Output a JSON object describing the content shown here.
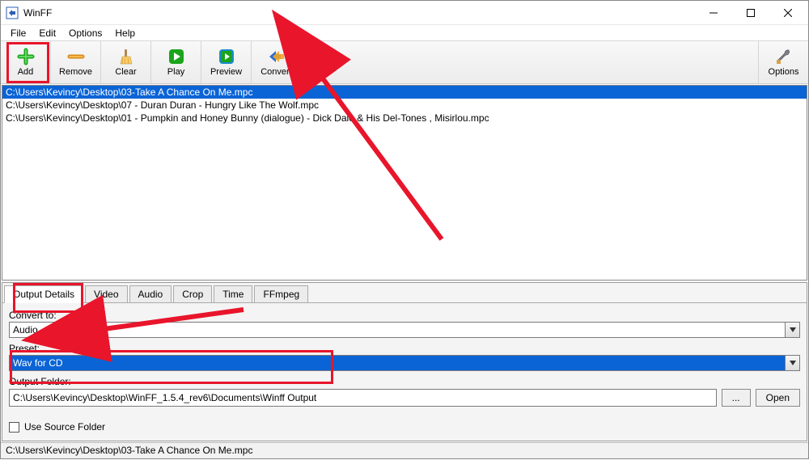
{
  "window": {
    "title": "WinFF"
  },
  "menu": {
    "items": [
      "File",
      "Edit",
      "Options",
      "Help"
    ]
  },
  "toolbar": {
    "add": "Add",
    "remove": "Remove",
    "clear": "Clear",
    "play": "Play",
    "preview": "Preview",
    "convert": "Convert",
    "options": "Options"
  },
  "files": [
    {
      "path": "C:\\Users\\Kevincy\\Desktop\\03-Take A Chance On Me.mpc",
      "selected": true
    },
    {
      "path": "C:\\Users\\Kevincy\\Desktop\\07 - Duran Duran - Hungry Like The Wolf.mpc",
      "selected": false
    },
    {
      "path": "C:\\Users\\Kevincy\\Desktop\\01 - Pumpkin and Honey Bunny (dialogue) - Dick Dale & His Del-Tones , Misirlou.mpc",
      "selected": false
    }
  ],
  "tabs": {
    "labels": [
      "Output Details",
      "Video",
      "Audio",
      "Crop",
      "Time",
      "FFmpeg"
    ],
    "active": 0
  },
  "output_details": {
    "convert_to_label": "Convert to:",
    "convert_to_value": "Audio",
    "preset_label": "Preset:",
    "preset_value": "Wav for CD",
    "output_folder_label": "Output Folder:",
    "output_folder_value": "C:\\Users\\Kevincy\\Desktop\\WinFF_1.5.4_rev6\\Documents\\Winff Output",
    "browse_label": "...",
    "open_label": "Open",
    "use_source_label": "Use Source Folder"
  },
  "statusbar": {
    "text": "C:\\Users\\Kevincy\\Desktop\\03-Take A Chance On Me.mpc"
  }
}
